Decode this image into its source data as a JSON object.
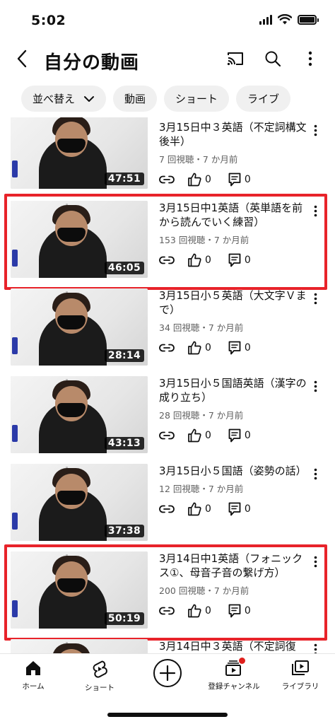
{
  "status_bar": {
    "time": "5:02"
  },
  "header": {
    "title": "自分の動画",
    "icons": [
      "back-icon",
      "cast-icon",
      "search-icon",
      "more-vert-icon"
    ]
  },
  "chips": [
    {
      "label": "並べ替え",
      "has_dropdown": true
    },
    {
      "label": "動画"
    },
    {
      "label": "ショート"
    },
    {
      "label": "ライブ"
    }
  ],
  "videos": [
    {
      "title": "3月15日中３英語（不定詞構文後半）",
      "meta": "7 回視聴・7 か月前",
      "likes": "0",
      "comments": "0",
      "duration": "47:51",
      "highlighted": false
    },
    {
      "title": "3月15日中1英語（英単語を前から読んでいく練習）",
      "meta": "153 回視聴・7 か月前",
      "likes": "0",
      "comments": "0",
      "duration": "46:05",
      "highlighted": true
    },
    {
      "title": "3月15日小５英語（大文字Ｖまで）",
      "meta": "34 回視聴・7 か月前",
      "likes": "0",
      "comments": "0",
      "duration": "28:14",
      "highlighted": false
    },
    {
      "title": "3月15日小５国語英語（漢字の成り立ち）",
      "meta": "28 回視聴・7 か月前",
      "likes": "0",
      "comments": "0",
      "duration": "43:13",
      "highlighted": false
    },
    {
      "title": "3月15日小５国語（姿勢の話）",
      "meta": "12 回視聴・7 か月前",
      "likes": "0",
      "comments": "0",
      "duration": "37:38",
      "highlighted": false
    },
    {
      "title": "3月14日中1英語（フォニックス①、母音子音の繋げ方）",
      "meta": "200 回視聴・7 か月前",
      "likes": "0",
      "comments": "0",
      "duration": "50:19",
      "highlighted": true
    },
    {
      "title": "3月14日中３英語（不定詞復",
      "meta": "",
      "likes": "",
      "comments": "",
      "duration": "",
      "highlighted": false
    }
  ],
  "bottom_nav": {
    "home": "ホーム",
    "shorts": "ショート",
    "subscriptions": "登録チャンネル",
    "library": "ライブラリ"
  },
  "colors": {
    "highlight": "#e8232a",
    "notification_dot": "#e0201d",
    "meta_text": "#606060"
  }
}
